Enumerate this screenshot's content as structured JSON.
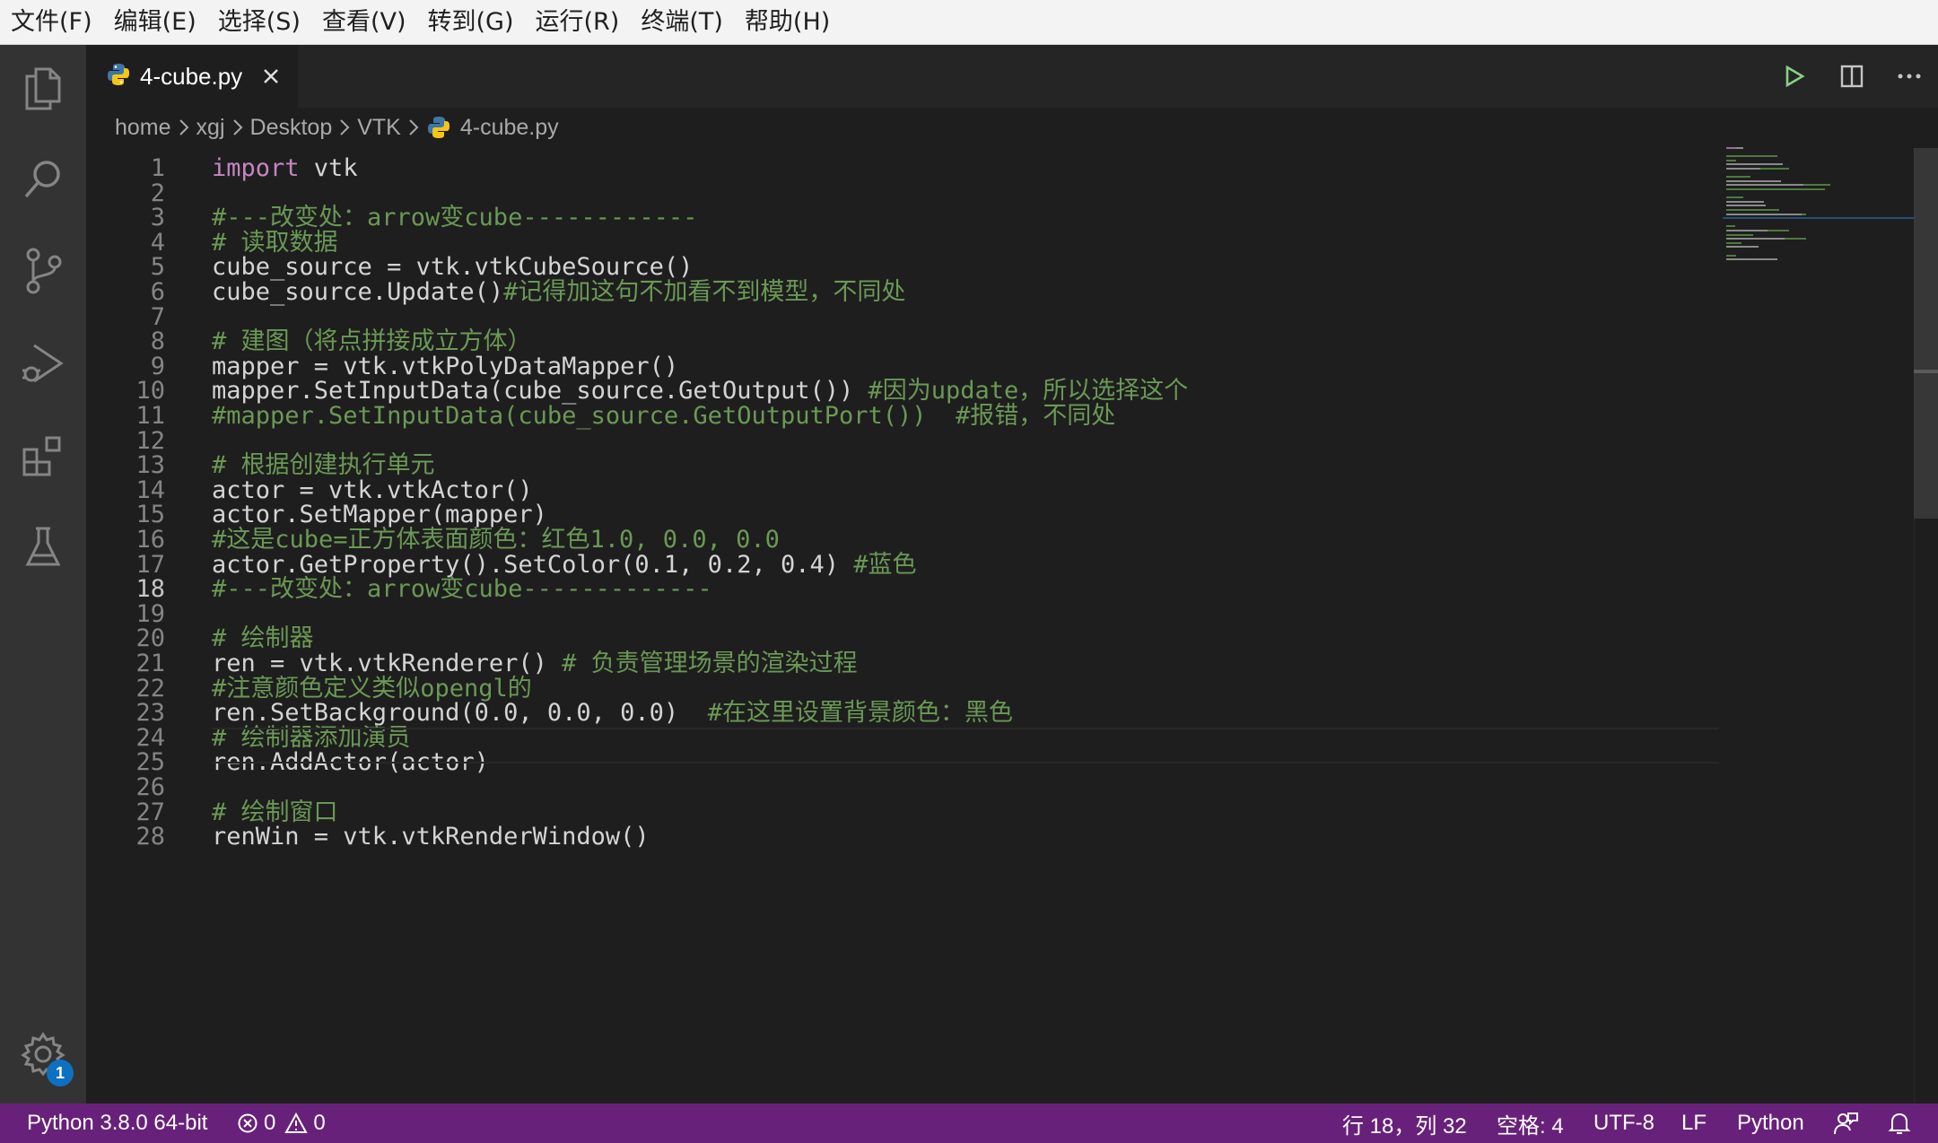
{
  "menu": [
    "文件(F)",
    "编辑(E)",
    "选择(S)",
    "查看(V)",
    "转到(G)",
    "运行(R)",
    "终端(T)",
    "帮助(H)"
  ],
  "activity": {
    "icons": [
      "files-icon",
      "search-icon",
      "source-control-icon",
      "run-debug-icon",
      "extensions-icon",
      "testing-icon"
    ],
    "settings_badge": "1"
  },
  "tab": {
    "label": "4-cube.py"
  },
  "breadcrumb": [
    "home",
    "xgj",
    "Desktop",
    "VTK",
    "4-cube.py"
  ],
  "code": {
    "active_line": 18,
    "lines": [
      [
        [
          "kw",
          "import"
        ],
        [
          "t",
          " vtk"
        ]
      ],
      [],
      [
        [
          "cm",
          "#---改变处：arrow变cube------------"
        ]
      ],
      [
        [
          "cm",
          "# 读取数据"
        ]
      ],
      [
        [
          "t",
          "cube_source = vtk.vtkCubeSource()"
        ]
      ],
      [
        [
          "t",
          "cube_source.Update()"
        ],
        [
          "cm",
          "#记得加这句不加看不到模型，不同处"
        ]
      ],
      [],
      [
        [
          "cm",
          "# 建图（将点拼接成立方体）"
        ]
      ],
      [
        [
          "t",
          "mapper = vtk.vtkPolyDataMapper()"
        ]
      ],
      [
        [
          "t",
          "mapper.SetInputData(cube_source.GetOutput()) "
        ],
        [
          "cm",
          "#因为update，所以选择这个"
        ]
      ],
      [
        [
          "cm",
          "#mapper.SetInputData(cube_source.GetOutputPort())  #报错，不同处"
        ]
      ],
      [],
      [
        [
          "cm",
          "# 根据创建执行单元"
        ]
      ],
      [
        [
          "t",
          "actor = vtk.vtkActor()"
        ]
      ],
      [
        [
          "t",
          "actor.SetMapper(mapper)"
        ]
      ],
      [
        [
          "cm",
          "#这是cube=正方体表面颜色：红色1.0, 0.0, 0.0"
        ]
      ],
      [
        [
          "t",
          "actor.GetProperty().SetColor(0.1, 0.2, 0.4) "
        ],
        [
          "cm",
          "#蓝色"
        ]
      ],
      [
        [
          "cm",
          "#---改变处：arrow变cube-------------"
        ]
      ],
      [],
      [
        [
          "cm",
          "# 绘制器"
        ]
      ],
      [
        [
          "t",
          "ren = vtk.vtkRenderer() "
        ],
        [
          "cm",
          "# 负责管理场景的渲染过程"
        ]
      ],
      [
        [
          "cm",
          "#注意颜色定义类似opengl的"
        ]
      ],
      [
        [
          "t",
          "ren.SetBackground(0.0, 0.0, 0.0)  "
        ],
        [
          "cm",
          "#在这里设置背景颜色：黑色"
        ]
      ],
      [
        [
          "cm",
          "# 绘制器添加演员"
        ]
      ],
      [
        [
          "t",
          "ren.AddActor(actor)"
        ]
      ],
      [],
      [
        [
          "cm",
          "# 绘制窗口"
        ]
      ],
      [
        [
          "t",
          "renWin = vtk.vtkRenderWindow()"
        ]
      ]
    ]
  },
  "status": {
    "interpreter": "Python 3.8.0 64-bit",
    "errors": "0",
    "warnings": "0",
    "position": "行 18，列 32",
    "indent": "空格: 4",
    "encoding": "UTF-8",
    "eol": "LF",
    "language": "Python"
  },
  "colors": {
    "statusbar": "#68217a",
    "comment": "#6a9955",
    "keyword": "#c586c0",
    "text": "#d4d4d4",
    "badge": "#0e70c0"
  }
}
